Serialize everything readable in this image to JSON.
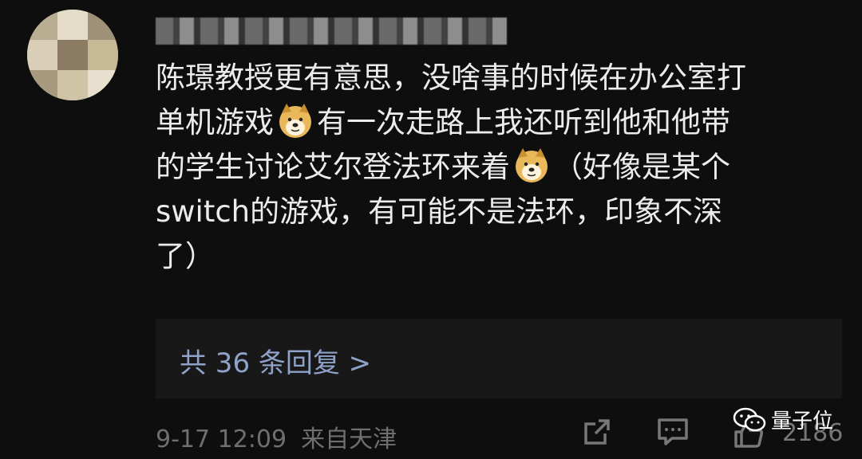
{
  "comment": {
    "lines": [
      "陈璟教授更有意思，没啥事的时候在办公室打",
      "单机游戏",
      "有一次走路上我还听到他和他带",
      "的学生讨论艾尔登法环来着",
      "（好像是某个",
      "switch的游戏，有可能不是法环，印象不深",
      "了）"
    ],
    "emoji": "doge-emoji"
  },
  "replies": {
    "label": "共 36 条回复 >"
  },
  "meta": {
    "date": "9-17 12:09",
    "location": "来自天津"
  },
  "actions": {
    "share_icon": "share-icon",
    "comment_icon": "comment-icon",
    "like_icon": "thumbs-up-icon",
    "like_count": "2186"
  },
  "watermark": {
    "text": "量子位"
  },
  "colors": {
    "background": "#0e0e0e",
    "link": "#8fa2c9",
    "meta": "#6f6f6f"
  }
}
